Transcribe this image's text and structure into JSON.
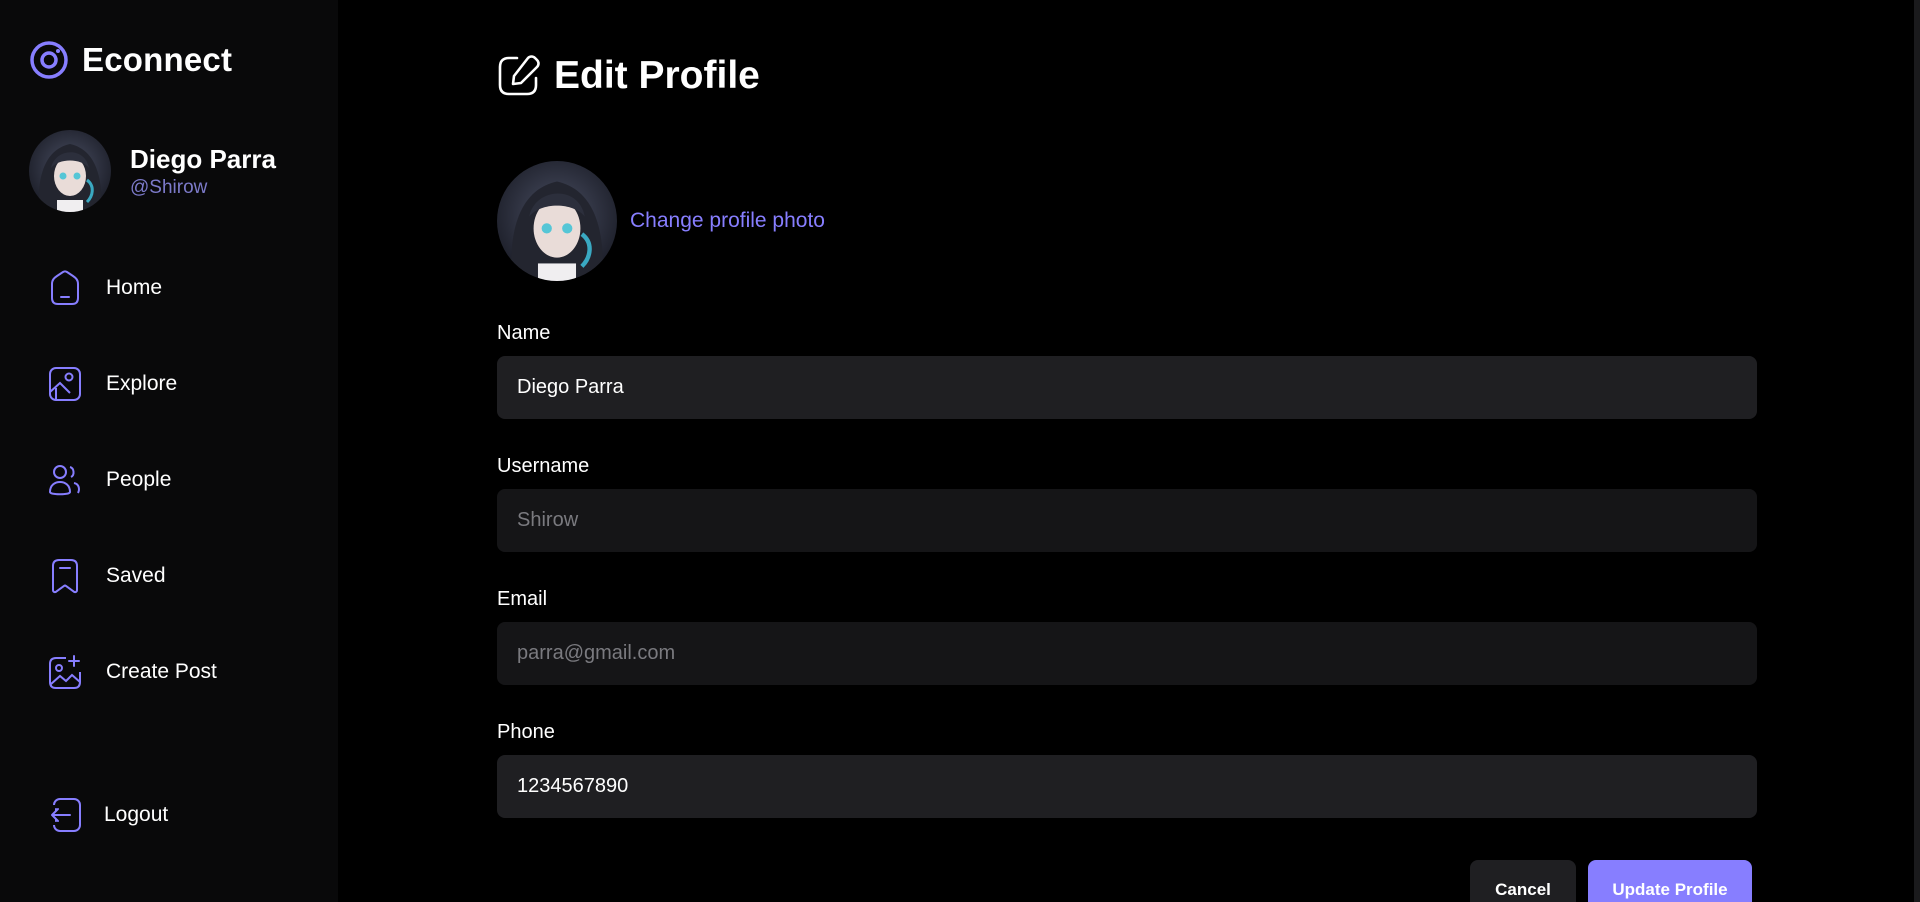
{
  "app": {
    "brand_name": "Econnect",
    "accent_color": "#877eff"
  },
  "user": {
    "name": "Diego Parra",
    "handle": "@Shirow"
  },
  "sidebar": {
    "items": [
      {
        "label": "Home",
        "icon": "home-icon"
      },
      {
        "label": "Explore",
        "icon": "gallery-icon"
      },
      {
        "label": "People",
        "icon": "people-icon"
      },
      {
        "label": "Saved",
        "icon": "bookmark-icon"
      },
      {
        "label": "Create Post",
        "icon": "image-add-icon"
      }
    ],
    "logout_label": "Logout"
  },
  "page": {
    "title": "Edit Profile",
    "change_photo_label": "Change profile photo"
  },
  "form": {
    "name": {
      "label": "Name",
      "value": "Diego Parra"
    },
    "username": {
      "label": "Username",
      "value": "Shirow"
    },
    "email": {
      "label": "Email",
      "value": "parra@gmail.com"
    },
    "phone": {
      "label": "Phone",
      "value": "1234567890"
    }
  },
  "actions": {
    "cancel_label": "Cancel",
    "update_label": "Update Profile"
  }
}
